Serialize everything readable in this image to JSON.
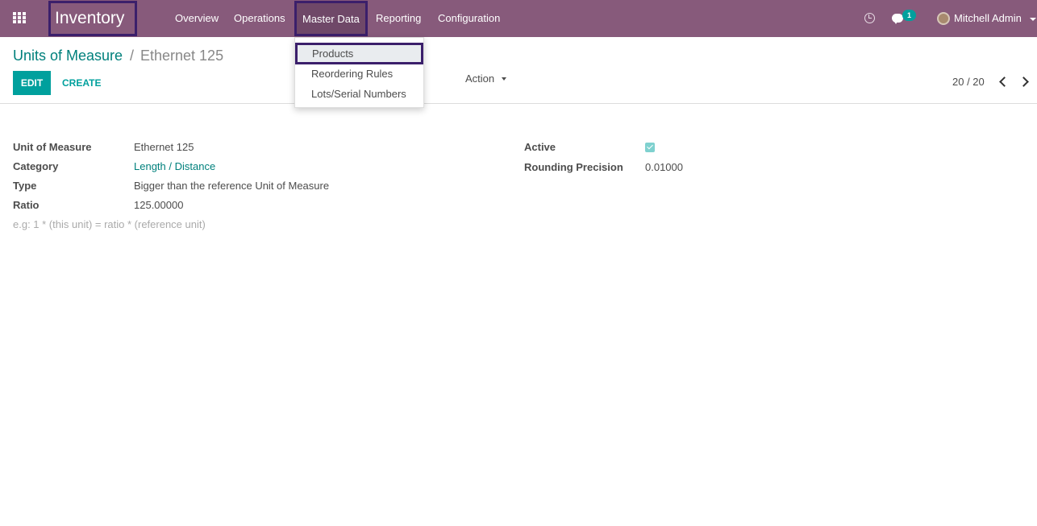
{
  "navbar": {
    "app_title": "Inventory",
    "menu": {
      "overview": "Overview",
      "operations": "Operations",
      "master_data": "Master Data",
      "reporting": "Reporting",
      "configuration": "Configuration"
    },
    "message_count": "1",
    "user_name": "Mitchell Admin",
    "color": "#875a7b"
  },
  "dropdown": {
    "items": [
      "Products",
      "Reordering Rules",
      "Lots/Serial Numbers"
    ]
  },
  "breadcrumb": {
    "parent": "Units of Measure",
    "separator": "/",
    "current": "Ethernet 125"
  },
  "toolbar": {
    "edit_label": "EDIT",
    "create_label": "CREATE",
    "action_label": "Action",
    "pager": "20 / 20"
  },
  "form": {
    "unit_of_measure_label": "Unit of Measure",
    "unit_of_measure_value": "Ethernet 125",
    "category_label": "Category",
    "category_value": "Length / Distance",
    "type_label": "Type",
    "type_value": "Bigger than the reference Unit of Measure",
    "ratio_label": "Ratio",
    "ratio_value": "125.00000",
    "ratio_hint": "e.g: 1 * (this unit) = ratio * (reference unit)",
    "active_label": "Active",
    "rounding_label": "Rounding Precision",
    "rounding_value": "0.01000"
  }
}
